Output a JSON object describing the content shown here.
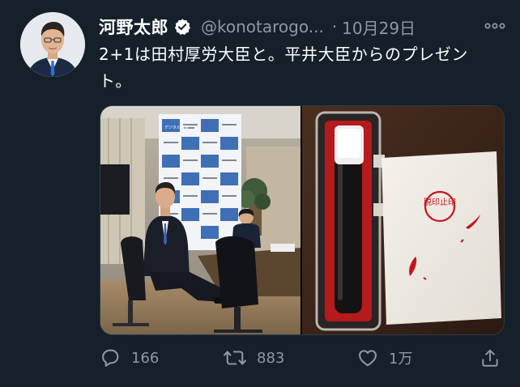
{
  "author": {
    "display_name": "河野太郎",
    "handle": "@konotarogo...",
    "separator": "·",
    "date": "10月29日"
  },
  "tweet": {
    "text_line1": "2+1は田村厚労大臣と。平井大臣からのプレゼン",
    "text_line2": "ト。"
  },
  "photos": {
    "left_sign_text": "デジタル改革",
    "right_stamp_text": "脱印止印"
  },
  "actions": {
    "replies": "166",
    "retweets": "883",
    "likes": "1万"
  },
  "icons": {
    "verified": "verified-badge-icon",
    "more": "more-icon",
    "reply": "reply-icon",
    "retweet": "retweet-icon",
    "like": "heart-icon",
    "share": "share-icon"
  },
  "colors": {
    "background": "#15202b",
    "secondary_text": "#8b98a5",
    "stamp_red": "#c4161c"
  }
}
